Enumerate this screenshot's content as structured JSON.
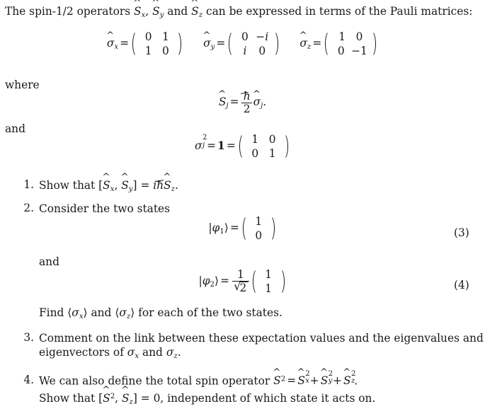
{
  "document": {
    "type": "physics-problem-sheet",
    "topic": "Spin-1/2 operators and Pauli matrices",
    "intro": {
      "text_before": "The spin-1/2 operators",
      "op_x": "S",
      "op_x_sub": "x",
      "comma1": ",",
      "op_y": "S",
      "op_y_sub": "y",
      "and_word": "and",
      "op_z": "S",
      "op_z_sub": "z",
      "text_after": "can be expressed in terms of the Pauli matrices:"
    },
    "pauli": {
      "sigma_x": {
        "symbol": "σ",
        "sub": "x",
        "equals": "=",
        "rows": [
          [
            "0",
            "1"
          ],
          [
            "1",
            "0"
          ]
        ]
      },
      "sigma_y": {
        "symbol": "σ",
        "sub": "y",
        "equals": "=",
        "rows": [
          [
            "0",
            "−i"
          ],
          [
            "i",
            "0"
          ]
        ]
      },
      "sigma_z": {
        "symbol": "σ",
        "sub": "z",
        "equals": "=",
        "rows": [
          [
            "1",
            "0"
          ],
          [
            "0",
            "−1"
          ]
        ]
      }
    },
    "where_label": "where",
    "spin_def": {
      "lhs_symbol": "S",
      "lhs_sub": "j",
      "equals": "=",
      "numerator": "ħ",
      "denominator": "2",
      "rhs_symbol": "σ",
      "rhs_sub": "j",
      "period": "."
    },
    "and_label": "and",
    "identity_def": {
      "lhs_symbol": "σ",
      "lhs_sub": "j",
      "lhs_sup": "2",
      "equals_1": "=",
      "one": "1",
      "equals_2": "=",
      "rows": [
        [
          "1",
          "0"
        ],
        [
          "0",
          "1"
        ]
      ]
    },
    "items": [
      {
        "number": "1.",
        "text_a": "Show that [",
        "sym_sx": "S",
        "sub_sx": "x",
        "comma": ",",
        "sym_sy": "S",
        "sub_sy": "y",
        "text_b": "] =",
        "imaginary": "i",
        "hbar": "ħ",
        "sym_sz": "S",
        "sub_sz": "z",
        "period": "."
      },
      {
        "number": "2.",
        "text": "Consider the two states",
        "and_label": "and",
        "find_text_a": "Find",
        "find_sym1": "σ",
        "find_sub1": "x",
        "find_and": "and",
        "find_sym2": "σ",
        "find_sub2": "z",
        "find_text_b": "for each of the two states."
      },
      {
        "number": "3.",
        "line1": "Comment on the link between these expectation values and the eigenvalues and",
        "line2_a": "eigenvectors of",
        "line2_sym1": "σ",
        "line2_sub1": "x",
        "line2_and": "and",
        "line2_sym2": "σ",
        "line2_sub2": "z",
        "line2_end": "."
      },
      {
        "number": "4.",
        "line1_a": "We can also define the total spin operator",
        "line1_S": "S",
        "line1_S_sup": "2",
        "line1_eq": "=",
        "line1_t1": "S",
        "line1_t1_sup": "2",
        "line1_t1_sub": "x",
        "plus1": "+",
        "line1_t2": "S",
        "line1_t2_sup": "2",
        "line1_t2_sub": "y",
        "plus2": "+",
        "line1_t3": "S",
        "line1_t3_sup": "2",
        "line1_t3_sub": "z",
        "line1_end": ".",
        "line2_a": "Show that [",
        "line2_S": "S",
        "line2_S_sup": "2",
        "line2_comma": ",",
        "line2_Sz": "S",
        "line2_Sz_sub": "z",
        "line2_b": "] = 0, independent of which state it acts on."
      }
    ],
    "equations": [
      {
        "number": "(3)",
        "ket_open": "|",
        "phi": "φ",
        "phi_sub": "1",
        "ket_close": "⟩",
        "equals": "=",
        "rows": [
          [
            "1"
          ],
          [
            "0"
          ]
        ]
      },
      {
        "number": "(4)",
        "ket_open": "|",
        "phi": "φ",
        "phi_sub": "2",
        "ket_close": "⟩",
        "equals": "=",
        "frac_num": "1",
        "frac_den_radical": "√",
        "frac_den_value": "2",
        "rows": [
          [
            "1"
          ],
          [
            "1"
          ]
        ]
      }
    ],
    "colors": {
      "text": "#1a1a1a",
      "background": "#ffffff"
    }
  }
}
